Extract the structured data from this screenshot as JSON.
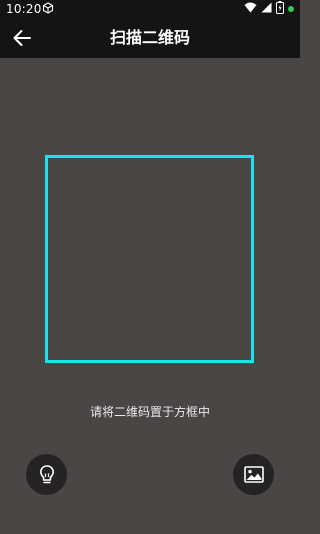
{
  "status_bar": {
    "time": "10:20",
    "left_icons": [
      "cube-icon"
    ],
    "right_icons": [
      "wifi-icon",
      "signal-icon",
      "battery-icon",
      "notification-dot-icon"
    ],
    "dot_color": "#2ecc55"
  },
  "app_bar": {
    "back_icon": "arrow-left-icon",
    "title": "扫描二维码"
  },
  "scanner": {
    "frame_color": "#1fe3e8",
    "hint": "请将二维码置于方框中"
  },
  "actions": {
    "flash_icon": "lightbulb-icon",
    "album_icon": "image-icon"
  },
  "colors": {
    "background": "#4a4646",
    "bar_background": "#141414",
    "button_background": "#252323"
  }
}
